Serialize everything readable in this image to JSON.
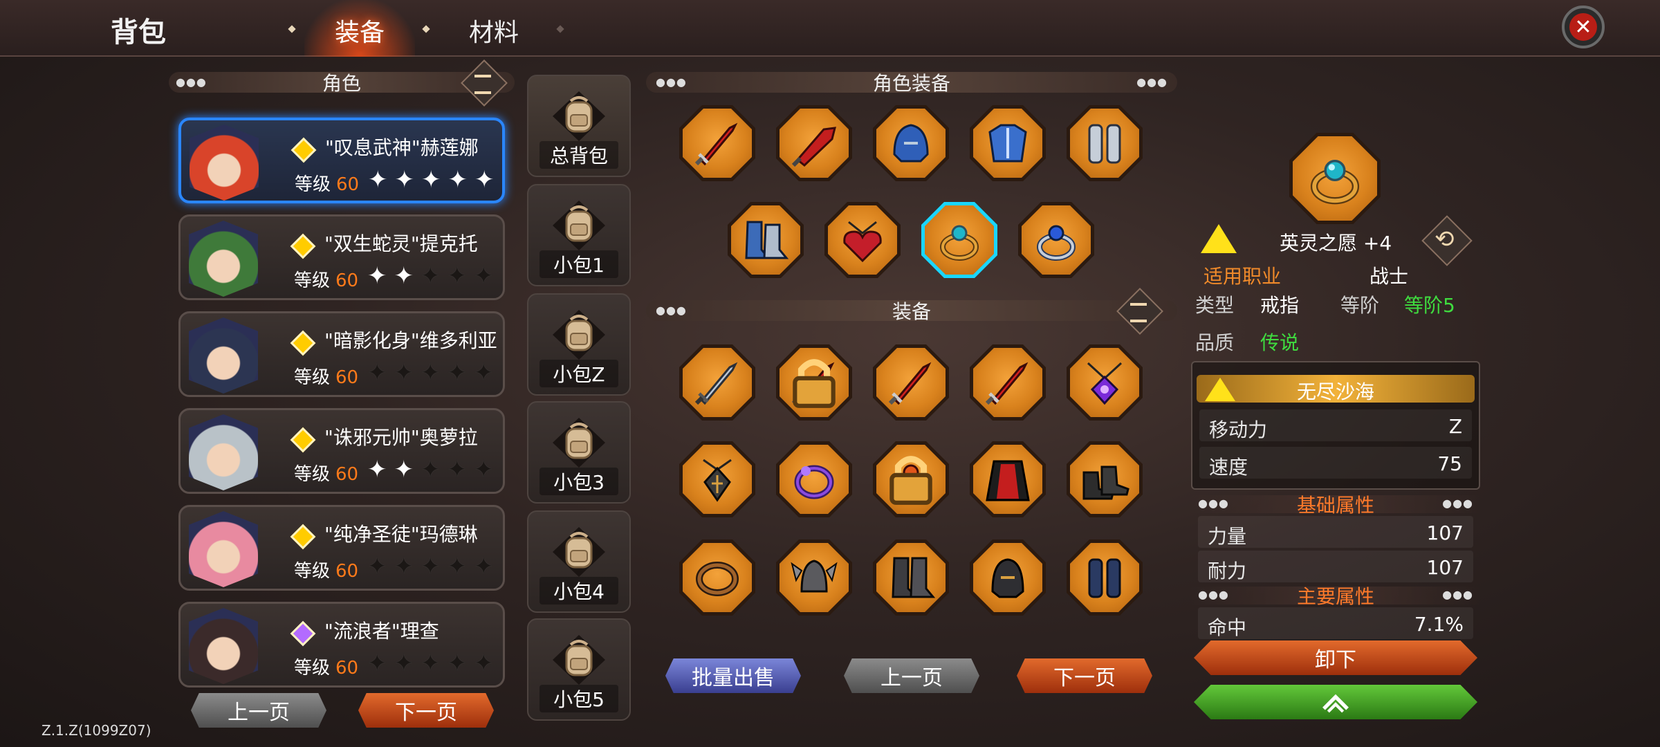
{
  "header": {
    "title": "背包",
    "tabs": [
      {
        "label": "装备",
        "active": true
      },
      {
        "label": "材料",
        "active": false
      }
    ]
  },
  "roles": {
    "header": "角色",
    "characters": [
      {
        "name": "\"叹息武神\"赫莲娜",
        "level_label": "等级",
        "level": "60",
        "stars": 5,
        "gem_color": "#ffcc00",
        "selected": true,
        "hair": "#d9442a"
      },
      {
        "name": "\"双生蛇灵\"提克托",
        "level_label": "等级",
        "level": "60",
        "stars": 2,
        "gem_color": "#ffcc00",
        "selected": false,
        "hair": "#3f7a3a"
      },
      {
        "name": "\"暗影化身\"维多利亚",
        "level_label": "等级",
        "level": "60",
        "stars": 0,
        "gem_color": "#ffcc00",
        "selected": false,
        "hair": "#2c3552"
      },
      {
        "name": "\"诛邪元帅\"奥萝拉",
        "level_label": "等级",
        "level": "60",
        "stars": 2,
        "gem_color": "#ffcc00",
        "selected": false,
        "hair": "#b9c2c8"
      },
      {
        "name": "\"纯净圣徒\"玛德琳",
        "level_label": "等级",
        "level": "60",
        "stars": 0,
        "gem_color": "#ffcc00",
        "selected": false,
        "hair": "#e88aa0"
      },
      {
        "name": "\"流浪者\"理查",
        "level_label": "等级",
        "level": "60",
        "stars": 0,
        "gem_color": "#b36bff",
        "selected": false,
        "hair": "#3b2a2a"
      }
    ],
    "prev": "上一页",
    "next": "下一页"
  },
  "bags": [
    {
      "label": "总背包",
      "active": true
    },
    {
      "label": "小包1",
      "active": false
    },
    {
      "label": "小包Z",
      "active": false
    },
    {
      "label": "小包3",
      "active": false
    },
    {
      "label": "小包4",
      "active": false
    },
    {
      "label": "小包5",
      "active": false
    }
  ],
  "char_equipment": {
    "header": "角色装备",
    "slots": [
      {
        "icon": "red-sword-icon"
      },
      {
        "icon": "red-cleaver-icon"
      },
      {
        "icon": "blue-helmet-icon"
      },
      {
        "icon": "blue-armor-icon"
      },
      {
        "icon": "silver-greaves-icon"
      },
      {
        "icon": "blue-boots-icon"
      },
      {
        "icon": "heart-amulet-icon"
      },
      {
        "icon": "teal-gem-ring-icon",
        "selected": true
      },
      {
        "icon": "blue-gem-ring-icon"
      }
    ]
  },
  "inventory": {
    "header": "装备",
    "slots": [
      {
        "icon": "steel-sword-icon"
      },
      {
        "icon": "red-sword-icon",
        "locked": true
      },
      {
        "icon": "red-sword-icon"
      },
      {
        "icon": "red-sword-icon"
      },
      {
        "icon": "purple-amulet-icon"
      },
      {
        "icon": "rune-pendant-icon"
      },
      {
        "icon": "purple-bracelet-icon"
      },
      {
        "icon": "orange-gem-ring-icon",
        "locked": true
      },
      {
        "icon": "red-cloak-icon"
      },
      {
        "icon": "dark-boots-icon"
      },
      {
        "icon": "plain-ring-icon"
      },
      {
        "icon": "winged-helmet-icon"
      },
      {
        "icon": "iron-boots-icon"
      },
      {
        "icon": "dark-helmet-icon"
      },
      {
        "icon": "dark-greaves-icon"
      }
    ],
    "bulk_sell": "批量出售",
    "prev": "上一页",
    "next": "下一页"
  },
  "detail": {
    "item_name": "英灵之愿 +4",
    "class_label": "适用职业",
    "class_value": "战士",
    "type_label": "类型",
    "type_value": "戒指",
    "tier_label": "等阶",
    "tier_value": "等阶5",
    "quality_label": "品质",
    "quality_value": "传说",
    "set_name": "无尽沙海",
    "set_stats": [
      {
        "k": "移动力",
        "v": "Z"
      },
      {
        "k": "速度",
        "v": "75"
      }
    ],
    "base_header": "基础属性",
    "base_stats": [
      {
        "k": "力量",
        "v": "107"
      },
      {
        "k": "耐力",
        "v": "107"
      }
    ],
    "main_header": "主要属性",
    "main_stats": [
      {
        "k": "命中",
        "v": "7.1%"
      }
    ],
    "unequip": "卸下"
  },
  "version": "Z.1.Z(1099Z07)"
}
